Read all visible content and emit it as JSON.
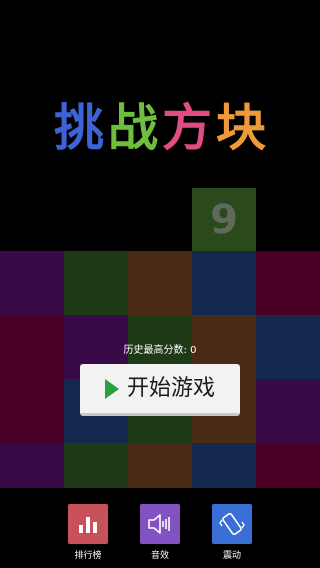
{
  "title": {
    "chars": [
      "挑",
      "战",
      "方",
      "块"
    ],
    "colors": [
      "#3d63d8",
      "#6fbf3f",
      "#e24b86",
      "#ef9a3a"
    ]
  },
  "board": {
    "colors": {
      "purple": "#3a0a48",
      "green": "#1e3a16",
      "brown": "#4a2a14",
      "navy": "#12284d",
      "maroon": "#4a0024",
      "olive_tile": "#2b4a1c"
    },
    "highlighted_tile": {
      "number": "9"
    }
  },
  "best_score": "历史最高分数: 0",
  "start_button": {
    "label": "开始游戏",
    "icon": "play-icon",
    "icon_color": "#27a23a"
  },
  "bottom_bar": {
    "items": [
      {
        "label": "排行榜",
        "icon": "bar-chart-icon",
        "color": "#c8515a"
      },
      {
        "label": "音效",
        "icon": "speaker-icon",
        "color": "#8352c2"
      },
      {
        "label": "震动",
        "icon": "vibrate-icon",
        "color": "#3b6fd6"
      }
    ]
  }
}
